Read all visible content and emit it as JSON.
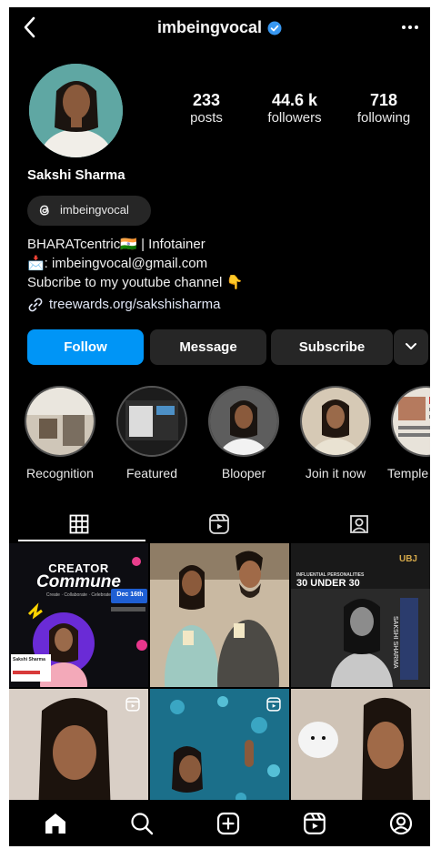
{
  "header": {
    "username": "imbeingvocal",
    "icons": {
      "back": "chevron-left-icon",
      "verified": "verified-badge-icon",
      "more": "more-horizontal-icon"
    }
  },
  "stats": [
    {
      "value": "233",
      "label": "posts"
    },
    {
      "value": "44.6 k",
      "label": "followers"
    },
    {
      "value": "718",
      "label": "following"
    }
  ],
  "profile": {
    "name": "Sakshi Sharma",
    "threads_handle": "imbeingvocal",
    "bio": [
      "BHARATcentric🇮🇳 | Infotainer",
      "📩: imbeingvocal@gmail.com",
      "Subcribe to my youtube channel 👇"
    ],
    "link": "treewards.org/sakshisharma"
  },
  "buttons": {
    "follow": "Follow",
    "message": "Message",
    "subscribe": "Subscribe"
  },
  "highlights": [
    {
      "label": "Recognition"
    },
    {
      "label": "Featured"
    },
    {
      "label": "Blooper"
    },
    {
      "label": "Join it now"
    },
    {
      "label": "Temple B"
    }
  ],
  "tabs": [
    {
      "name": "posts-grid",
      "icon": "grid-icon"
    },
    {
      "name": "reels",
      "icon": "reels-icon"
    },
    {
      "name": "tagged",
      "icon": "tagged-person-icon"
    }
  ],
  "grid": {
    "post1": {
      "brand": "CREATOR",
      "title": "Commune",
      "subtitle": "Create · Collaborate · Celebrate",
      "date": "Dec 16th",
      "badge_name": "Sakshi Sharma"
    },
    "post3": {
      "brand": "UBJ",
      "headline1": "INFLUENTIAL PERSONALITIES",
      "headline2": "30 UNDER 30",
      "side": "SAKSHI SHARMA"
    }
  },
  "bottom_nav": [
    {
      "name": "home",
      "icon": "home-icon"
    },
    {
      "name": "search",
      "icon": "search-icon"
    },
    {
      "name": "create",
      "icon": "plus-square-icon"
    },
    {
      "name": "reels",
      "icon": "reels-icon"
    },
    {
      "name": "profile",
      "icon": "profile-icon"
    }
  ],
  "colors": {
    "background": "#000000",
    "accent": "#0095f6",
    "button": "#262626",
    "text": "#ffffff"
  }
}
